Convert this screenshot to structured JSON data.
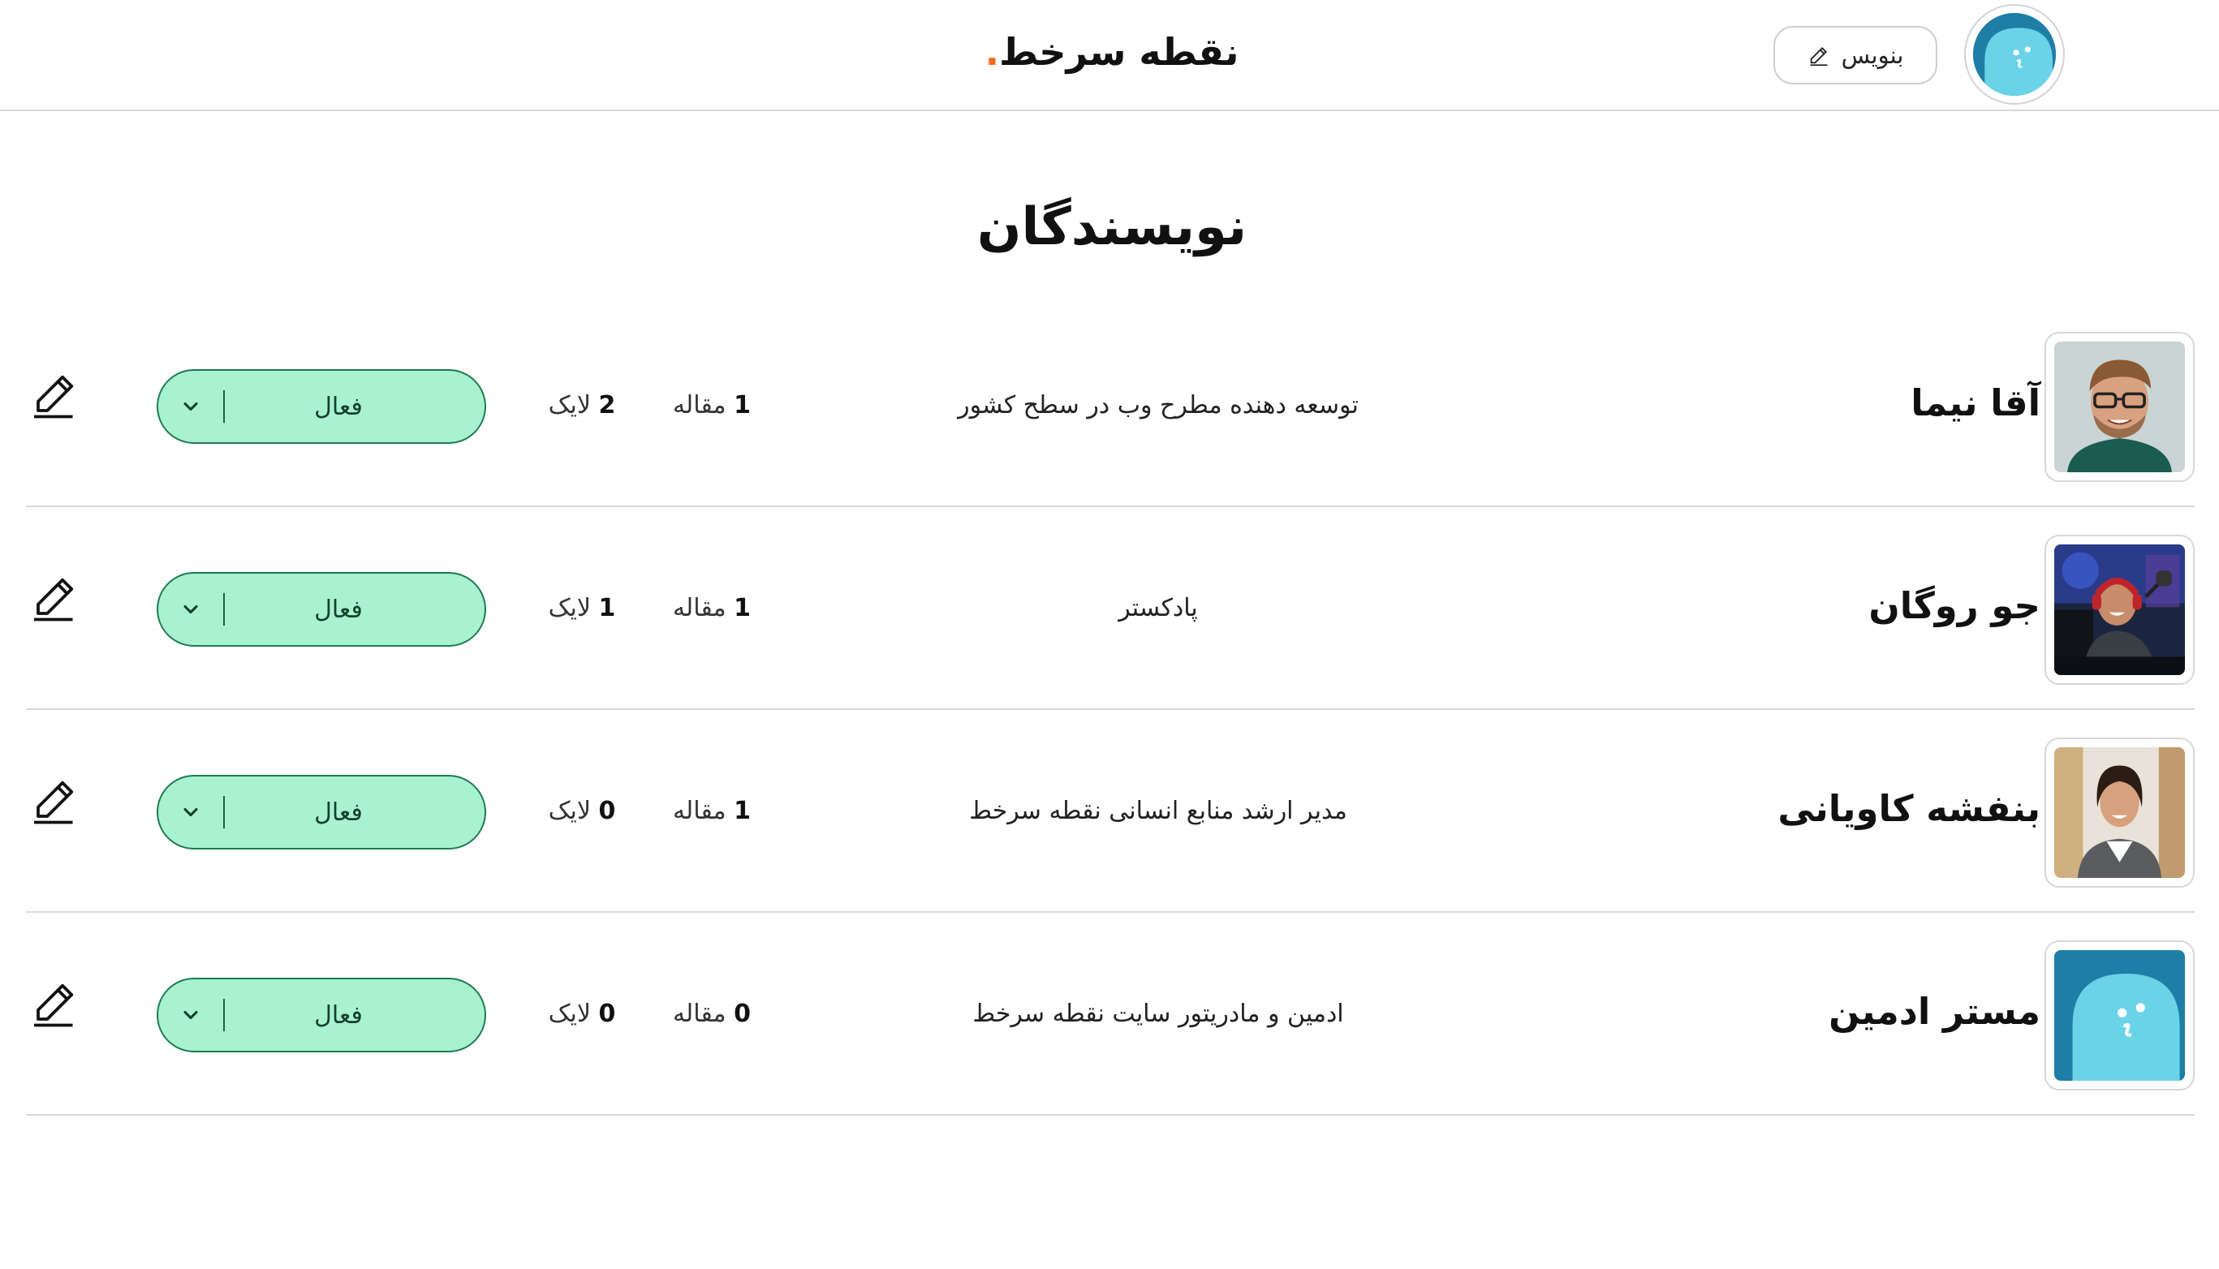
{
  "header": {
    "brand_text": "نقطه سرخط",
    "brand_dot": ".",
    "write_button_label": "بنویس"
  },
  "page_title": "نویسندگان",
  "writers": [
    {
      "name": "آقا نیما",
      "bio": "توسعه دهنده مطرح وب در سطح کشور",
      "articles_count": "1",
      "articles_label": "مقاله",
      "likes_count": "2",
      "likes_label": "لایک",
      "status": "فعال"
    },
    {
      "name": "جو روگان",
      "bio": "پادکستر",
      "articles_count": "1",
      "articles_label": "مقاله",
      "likes_count": "1",
      "likes_label": "لایک",
      "status": "فعال"
    },
    {
      "name": "بنفشه کاویانی",
      "bio": "مدیر ارشد منابع انسانی نقطه سرخط",
      "articles_count": "1",
      "articles_label": "مقاله",
      "likes_count": "0",
      "likes_label": "لایک",
      "status": "فعال"
    },
    {
      "name": "مستر ادمین",
      "bio": "ادمین و مادریتور سایت نقطه سرخط",
      "articles_count": "0",
      "articles_label": "مقاله",
      "likes_count": "0",
      "likes_label": "لایک",
      "status": "فعال"
    }
  ],
  "colors": {
    "brand_dot": "#f36a1d",
    "status_bg": "#a8f2d0",
    "status_border": "#1e7b52",
    "avatar_dark": "#1f7ea6",
    "avatar_light": "#6bd3e8"
  },
  "icons": {
    "write": "pencil-icon",
    "edit": "pencil-icon",
    "status_toggle": "chevron-down-icon"
  }
}
